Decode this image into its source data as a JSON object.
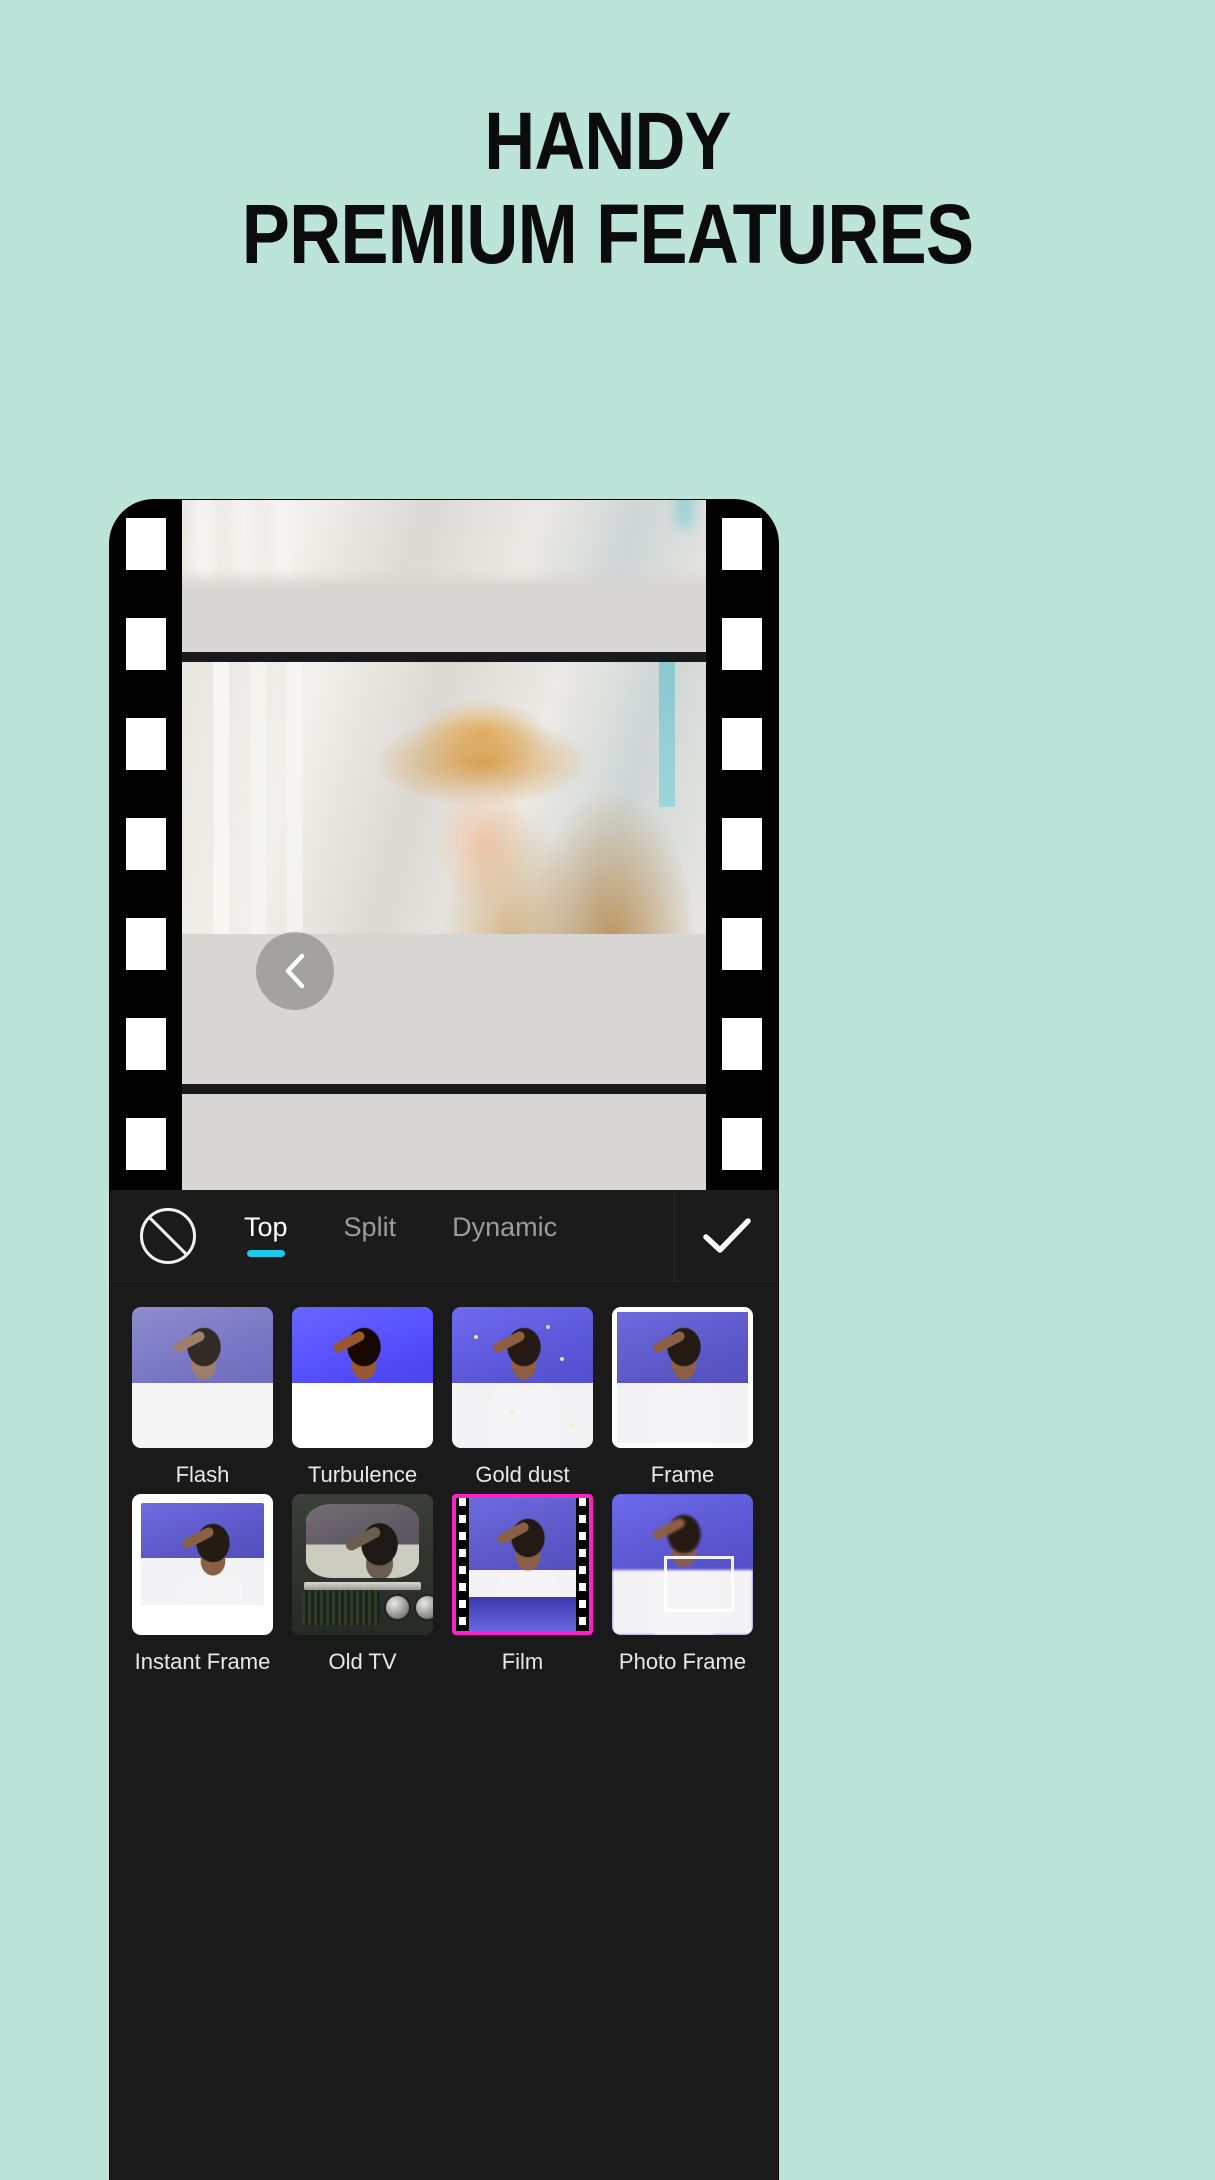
{
  "background_color": "#bde4d9",
  "headline": {
    "line1": "HANDY",
    "line2": "PREMIUM FEATURES"
  },
  "phone": {
    "photo_viewer": {
      "back_icon": "chevron-left-icon",
      "share_icon": "share-icon"
    },
    "toolbar": {
      "none_icon": "no-effect-icon",
      "tabs": [
        {
          "label": "Top",
          "active": true
        },
        {
          "label": "Split",
          "active": false
        },
        {
          "label": "Dynamic",
          "active": false
        }
      ],
      "confirm_icon": "check-icon",
      "active_tab_color": "#1ec8e8"
    },
    "filters": {
      "selected": "Film",
      "selection_color": "#ff21c8",
      "rows": [
        [
          {
            "label": "Flash",
            "variant": "v-flash",
            "overlay": "none"
          },
          {
            "label": "Turbulence",
            "variant": "v-turb",
            "overlay": "none"
          },
          {
            "label": "Gold dust",
            "variant": "v-gold",
            "overlay": "gold"
          },
          {
            "label": "Frame",
            "variant": "v-plain",
            "overlay": "framebox"
          }
        ],
        [
          {
            "label": "Instant Frame",
            "variant": "v-plain",
            "overlay": "instant"
          },
          {
            "label": "Old TV",
            "variant": "v-oldtv",
            "overlay": "oldtv"
          },
          {
            "label": "Film",
            "variant": "v-plain",
            "overlay": "filmperf"
          },
          {
            "label": "Photo Frame",
            "variant": "v-blur",
            "overlay": "photoframe"
          }
        ]
      ]
    }
  }
}
